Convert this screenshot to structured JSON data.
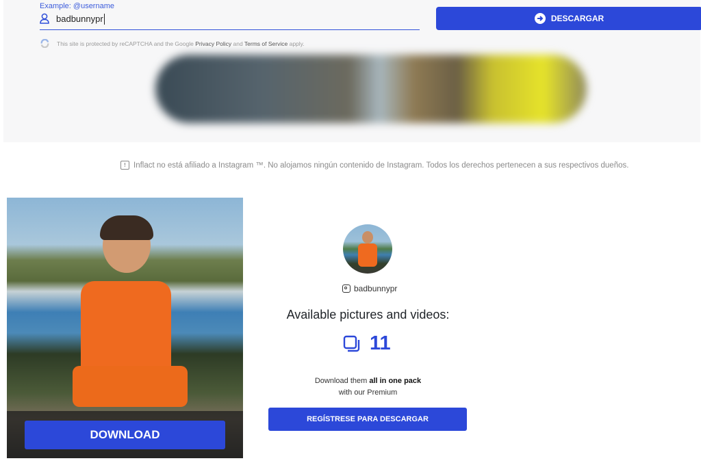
{
  "search": {
    "hint": "Example: @username",
    "value": "badbunnypr",
    "submit_label": "DESCARGAR"
  },
  "captcha": {
    "prefix": "This site is protected by reCAPTCHA and the Google",
    "privacy_link": "Privacy Policy",
    "and": "and",
    "terms_link": "Terms of Service",
    "suffix": "apply."
  },
  "disclaimer": {
    "text": "Inflact no está afiliado a Instagram ™. No alojamos ningún contenido de Instagram. Todos los derechos pertenecen a sus respectivos dueños."
  },
  "media_card": {
    "download_label": "DOWNLOAD"
  },
  "profile": {
    "username": "badbunnypr",
    "available_title": "Available pictures and videos:",
    "count": "11",
    "pack_line1_prefix": "Download them",
    "pack_line1_bold": "all in one pack",
    "pack_line2": "with our Premium",
    "register_label": "REGÍSTRESE PARA DESCARGAR"
  },
  "colors": {
    "accent": "#2c48d9",
    "panel_bg": "#f7f7f8"
  },
  "icons": [
    "user-icon",
    "arrow-right-circle-icon",
    "recaptcha-icon",
    "info-icon",
    "instagram-icon",
    "gallery-icon"
  ]
}
